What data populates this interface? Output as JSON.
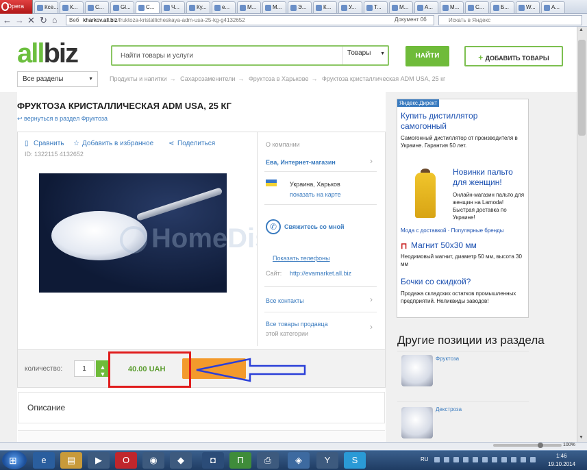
{
  "browser": {
    "menu_label": "Opera",
    "tabs": [
      "Ксе...",
      "К...",
      "С...",
      "Gl...",
      "С...",
      "Ч...",
      "Ку...",
      "e...",
      "М...",
      "М...",
      "Э...",
      "К...",
      "У...",
      "Т...",
      "М...",
      "А...",
      "М...",
      "С...",
      "Б...",
      "W...",
      "А..."
    ],
    "nav": {
      "back": "←",
      "forward": "→",
      "stop": "✕",
      "reload": "↻",
      "home": "⌂"
    },
    "address": {
      "scheme": "Веб",
      "host": "kharkov.all.biz",
      "path": "/fruktoza-kristallicheskaya-adm-usa-25-kg-g4132652"
    },
    "doc_status": "Документ 0б",
    "search_placeholder": "Искать в Яндекс"
  },
  "site": {
    "logo_all": "all",
    "logo_biz": "biz",
    "search_placeholder": "Найти товары и услуги",
    "search_category": "Товары",
    "find_button": "НАЙТИ",
    "add_goods_button": "ДОБАВИТЬ ТОВАРЫ",
    "all_sections": "Все разделы",
    "breadcrumb": [
      "Продукты и напитки",
      "Сахарозаменители",
      "Фруктоза в Харькове",
      "Фруктоза кристаллическая ADM USA, 25 кг"
    ]
  },
  "product": {
    "title": "ФРУКТОЗА КРИСТАЛЛИЧЕСКАЯ ADM USA, 25 КГ",
    "back_link": "вернуться в раздел Фруктоза",
    "compare": "Сравнить",
    "favourite": "Добавить в избранное",
    "share": "Поделиться",
    "id": "ID: 1322115  4132652",
    "watermark": "HomeDistiller.r",
    "quantity_label": "количество:",
    "quantity": "1",
    "price": "40.00 UAH",
    "description_title": "Описание"
  },
  "company": {
    "about": "О компании",
    "seller_name": "Ева, Интернет-магазин",
    "location": "Украина, Харьков",
    "show_map": "показать на карте",
    "contact_us": "Свяжитесь со мной",
    "show_phones": "Показать телефоны",
    "site_label": "Сайт:",
    "site_url": "http://evamarket.all.biz",
    "all_contacts": "Все контакты",
    "all_goods_line1": "Все товары продавца",
    "all_goods_line2": "этой категории"
  },
  "ads": {
    "tag": "Яндекс.Директ",
    "items": [
      {
        "title": "Купить дистиллятор самогонный",
        "text": "Самогонный дистиллятор от производителя в Украине. Гарантия 50 лет."
      },
      {
        "title": "Новинки пальто для женщин!",
        "text": "Онлайн-магазин пальто для женщин на Lamoda! Быстрая доставка по Украине!",
        "links": "Мода с доставкой · Популярные бренды"
      },
      {
        "title": "Магнит 50х30 мм",
        "text": "Неодимовый магнит, диаметр 50 мм, высота 30 мм"
      },
      {
        "title": "Бочки со скидкой?",
        "text": "Продажа складских остатков промышленных предприятий. Неликвиды заводов!"
      }
    ]
  },
  "other": {
    "title": "Другие позиции из раздела",
    "items": [
      "Фруктоза",
      "Декстроза"
    ]
  },
  "status": {
    "zoom": "100%"
  },
  "taskbar": {
    "start": "⊞",
    "lang": "RU",
    "time": "1:46",
    "date": "19.10.2014"
  },
  "colors": {
    "brand_green": "#6fbb3a",
    "link_blue": "#3a7bbf",
    "highlight_red": "#e01b1b",
    "buy_orange": "#f39a2c",
    "annotation_blue": "#2a3fd8"
  }
}
